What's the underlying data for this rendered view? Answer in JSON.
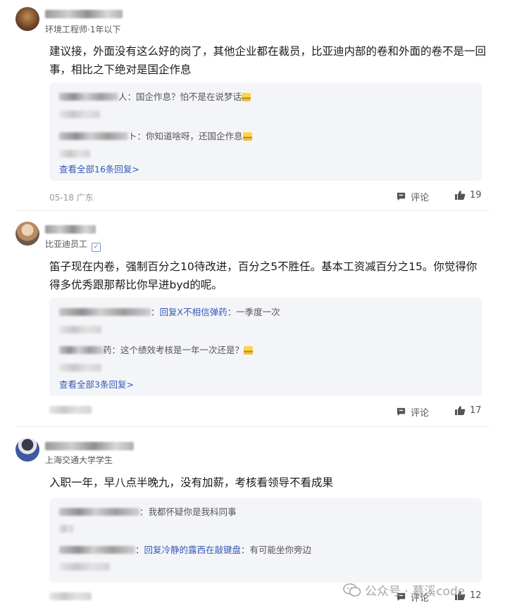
{
  "comments": [
    {
      "role": "环境工程师",
      "time": "1年以下",
      "verified": false,
      "text": "建议接，外面没有这么好的岗了，其他企业都在裁员，比亚迪内部的卷和外面的卷不是一回事，相比之下绝对是国企作息",
      "replies": [
        {
          "name_suffix": "人",
          "text": "国企作息？怕不是在说梦话",
          "emoji": true
        },
        {
          "name_suffix": "ト",
          "text": "你知道啥呀，还国企作息",
          "emoji": true
        }
      ],
      "view_all": "查看全部16条回复>",
      "footer": "05-18 广东",
      "comment_label": "评论",
      "likes": "19"
    },
    {
      "role": "比亚迪员工",
      "time": "",
      "verified": true,
      "text": "笛子现在内卷，强制百分之10待改进，百分之5不胜任。基本工资减百分之15。你觉得你得多优秀跟那帮比你早进byd的呢。",
      "replies": [
        {
          "name_suffix": "",
          "reply_to": "回复X不相信弹药",
          "text": "一季度一次",
          "emoji": false
        },
        {
          "name_suffix": "药",
          "text": "这个绩效考核是一年一次还是？",
          "emoji": true
        }
      ],
      "view_all": "查看全部3条回复>",
      "footer": "",
      "comment_label": "评论",
      "likes": "17"
    },
    {
      "role": "上海交通大学学生",
      "time": "",
      "verified": false,
      "text": "入职一年，早八点半晚九，没有加薪，考核看领导不看成果",
      "replies": [
        {
          "name_suffix": "",
          "text": "我都怀疑你是我科同事",
          "emoji": false
        },
        {
          "name_suffix": "",
          "reply_to": "回复冷静的露西在敲键盘",
          "text": "有可能坐你旁边",
          "emoji": false
        }
      ],
      "view_all": "",
      "footer": "",
      "comment_label": "评论",
      "likes": "12"
    }
  ],
  "watermark": {
    "text": "公众号 · 慕溪code",
    "icon": "wechat-icon"
  },
  "icons": {
    "comment": "comment-icon",
    "like": "thumbs-up-icon"
  },
  "colors": {
    "link": "#3559b8",
    "reply_bg": "#f4f5f8",
    "text": "#1a1a1a",
    "muted": "#999999"
  }
}
